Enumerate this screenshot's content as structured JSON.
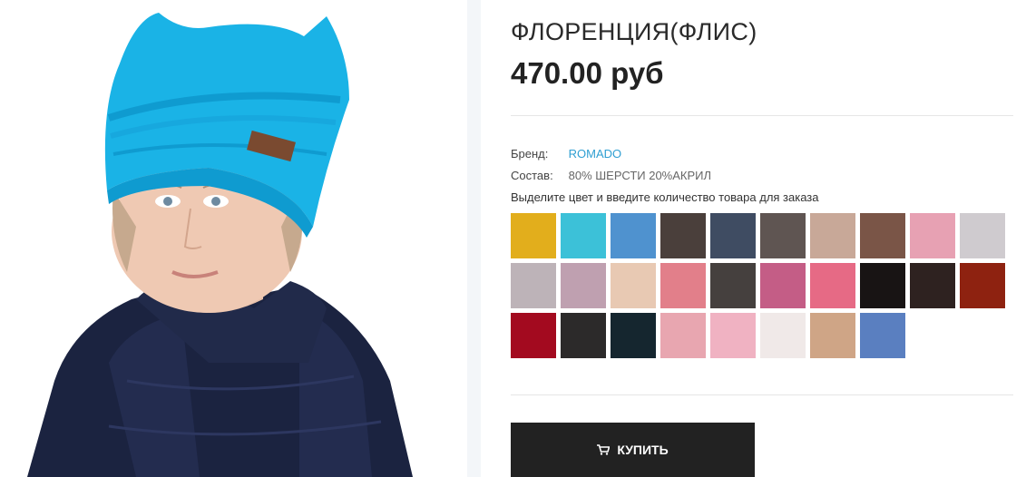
{
  "product": {
    "title": "ФЛОРЕНЦИЯ(ФЛИС)",
    "price": "470.00 руб",
    "brand_label": "Бренд:",
    "brand": "ROMADO",
    "composition_label": "Состав:",
    "composition": "80% ШЕРСТИ 20%АКРИЛ",
    "color_hint": "Выделите цвет и введите количество товара для заказа",
    "buy_label": "КУПИТЬ"
  },
  "swatches": [
    "#e2ae1c",
    "#3cc1d8",
    "#4f92cf",
    "#4a3f3b",
    "#3f4c62",
    "#5f5552",
    "#c8a898",
    "#7a5547",
    "#e7a1b3",
    "#cfcbcf",
    "#bdb3b8",
    "#bfa0b0",
    "#e8c9b3",
    "#e27f8a",
    "#45403e",
    "#c45d86",
    "#e66a85",
    "#181414",
    "#2e2220",
    "#8e2210",
    "#a30a1f",
    "#2c2a2a",
    "#15262f",
    "#e8a6b0",
    "#f0b2c2",
    "#f0e9e8",
    "#cfa586",
    "#5a7fc0"
  ],
  "icons": {
    "cart": "cart-icon"
  }
}
